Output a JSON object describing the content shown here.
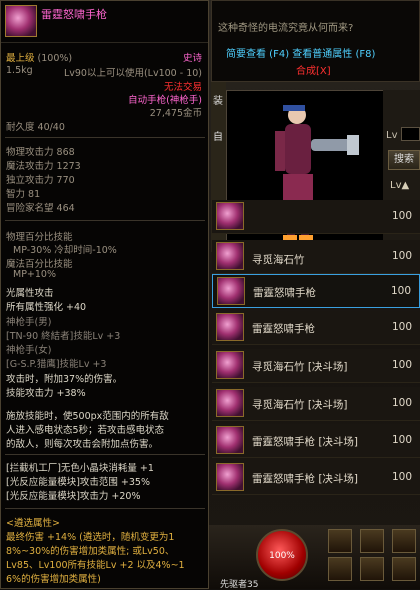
{
  "tooltip": {
    "name": "雷霆怒啸手枪",
    "top_level": "最上级",
    "top_level_pct": "(100%)",
    "rarity": "史诗",
    "weight": "1.5kg",
    "level_req": "Lv90以上可以使用(Lv100 - 10)",
    "trade": "无法交易",
    "type_prefix": "自动手枪",
    "type_suffix": "(神枪手)",
    "price": "27,475金币",
    "durability": "耐久度 40/40",
    "stats": [
      {
        "label": "物理攻击力",
        "value": "868"
      },
      {
        "label": "魔法攻击力",
        "value": "1273"
      },
      {
        "label": "独立攻击力",
        "value": "770"
      },
      {
        "label": "智力",
        "value": "81"
      },
      {
        "label": "冒险家名望",
        "value": "464"
      }
    ],
    "phys_skill_title": "物理百分比技能",
    "phys_skill_detail": "MP-30% 冷却时间-10%",
    "magic_skill_title": "魔法百分比技能",
    "magic_skill_detail": "MP+10%",
    "light_attr": "光属性攻击",
    "all_attr": "所有属性强化 +40",
    "gunner_m": "神枪手(男)",
    "gunner_m_skill": "[TN-90 終結者]技能Lv +3",
    "gunner_f": "神枪手(女)",
    "gunner_f_skill": "[G-S.P.猎鹰]技能Lv +3",
    "atk_extra": "攻击时，附加37%的伤害。",
    "skill_atk": "技能攻击力 +38%",
    "desc1": "施放技能时，使500px范围内的所有敌",
    "desc2": "人进入感电状态5秒；若攻击感电状态",
    "desc3": "的敌人，则每次攻击会附加点伤害。",
    "mod1": "[拦截机工厂]无色小晶块消耗量 +1",
    "mod2": "[光反应能量模块]攻击范围 +35%",
    "mod3": "[光反应能量模块]攻击力 +20%",
    "choose_title": "<遴选属性>",
    "choose1": "最终伤害 +14% (遴选时，随机变更为1",
    "choose2": "8%~30%的伤害增加类属性; 或Lv50、",
    "choose3": "Lv85、Lv100所有技能Lv +2 以及4%~1",
    "choose4": "6%的伤害增加类属性)"
  },
  "topbar": {
    "question": "这种奇怪的电流究竟从何而来?",
    "view_link": "简要查看 (F4) 查看普通属性 (F8)",
    "merge": "合成[X]"
  },
  "side_tabs": [
    "装",
    "自"
  ],
  "filter": {
    "lv_label": "Lv",
    "search_label": "搜索",
    "lv_sort": "Lv▲"
  },
  "list_items": [
    {
      "name": "",
      "lv": "100"
    },
    {
      "name": "寻觅海石竹",
      "lv": "100"
    },
    {
      "name": "雷霆怒啸手枪",
      "lv": "100"
    },
    {
      "name": "雷霆怒啸手枪",
      "lv": "100"
    },
    {
      "name": "寻觅海石竹 [决斗场]",
      "lv": "100"
    },
    {
      "name": "寻觅海石竹 [决斗场]",
      "lv": "100"
    },
    {
      "name": "雷霆怒啸手枪 [决斗场]",
      "lv": "100"
    },
    {
      "name": "雷霆怒啸手枪 [决斗场]",
      "lv": "100"
    }
  ],
  "hud": {
    "hp": "100%",
    "job": "先驱者35"
  },
  "colors": {
    "accent": "#ff66d0",
    "gold": "#e0b040",
    "link": "#4fd0ff"
  }
}
